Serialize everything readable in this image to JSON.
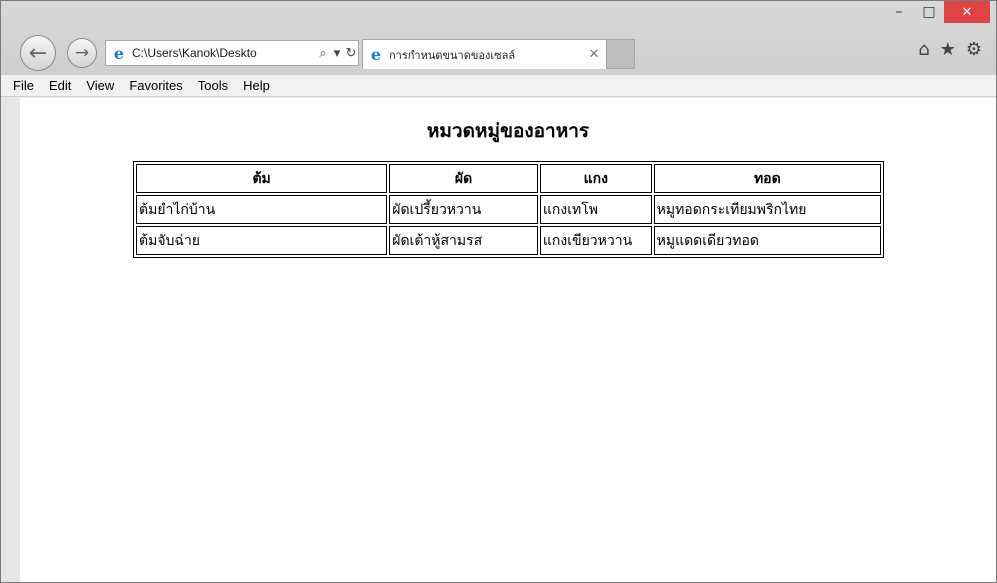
{
  "browser": {
    "address": "C:\\Users\\Kanok\\Deskto",
    "tab_title": "การกำหนดขนาดของเซลล์",
    "window_controls": {
      "minimize": "–",
      "maximize": "□",
      "close": "✕"
    }
  },
  "menu": [
    "File",
    "Edit",
    "View",
    "Favorites",
    "Tools",
    "Help"
  ],
  "page": {
    "title": "หมวดหมู่ของอาหาร",
    "table": {
      "headers": [
        "ต้ม",
        "ผัด",
        "แกง",
        "ทอด"
      ],
      "rows": [
        [
          "ต้มยำไก่บ้าน",
          "ผัดเปรี้ยวหวาน",
          "แกงเทโพ",
          "หมูทอดกระเทียมพริกไทย"
        ],
        [
          "ต้มจับฉ่าย",
          "ผัดเต้าหู้สามรส",
          "แกงเขียวหวาน",
          "หมูแดดเดียวทอด"
        ]
      ]
    }
  }
}
